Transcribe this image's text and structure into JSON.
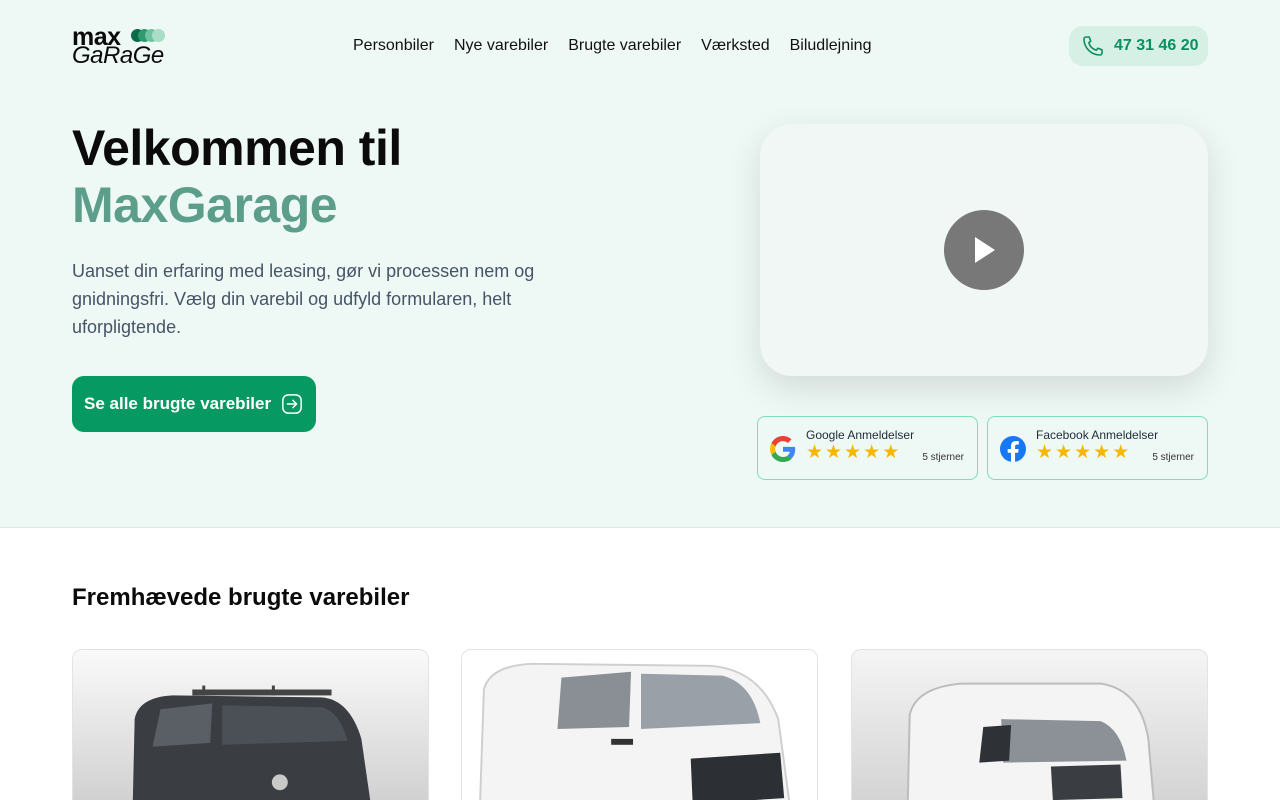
{
  "header": {
    "logo_top": "max",
    "logo_bottom": "GaRaGe",
    "nav": [
      "Personbiler",
      "Nye varebiler",
      "Brugte varebiler",
      "Værksted",
      "Biludlejning"
    ],
    "phone": "47 31 46 20",
    "phone_icon": "phone-icon"
  },
  "hero": {
    "title_line1": "Velkommen til",
    "title_line2": "MaxGarage",
    "lead": "Uanset din erfaring med leasing, gør vi processen nem og gnidningsfri. Vælg din varebil og udfyld formularen, helt uforpligtende.",
    "cta_label": "Se alle brugte varebiler",
    "cta_icon": "arrow-right-icon",
    "play_icon": "play-icon"
  },
  "reviews": [
    {
      "title": "Google Anmeldelser",
      "rating": 5,
      "count_label": "5 stjerner",
      "icon": "google-icon"
    },
    {
      "title": "Facebook Anmeldelser",
      "rating": 5,
      "count_label": "5 stjerner",
      "icon": "facebook-icon"
    }
  ],
  "featured": {
    "title": "Fremhævede brugte varebiler",
    "cards": [
      {
        "icon": "van-photo-dark",
        "color": "#3a3d42"
      },
      {
        "icon": "van-photo-white",
        "color": "#f2f2f2"
      },
      {
        "icon": "van-photo-white",
        "color": "#eeeeee"
      }
    ]
  },
  "colors": {
    "brand_green": "#069a62",
    "accent_teal": "#5c9e8a",
    "hero_bg": "#eef8f4",
    "star": "#f6b700"
  }
}
